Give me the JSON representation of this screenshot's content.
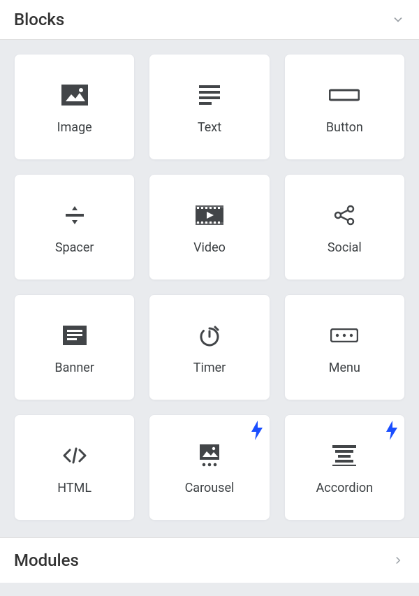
{
  "sections": {
    "blocks_title": "Blocks",
    "modules_title": "Modules"
  },
  "blocks": [
    {
      "label": "Image",
      "icon": "image-icon",
      "premium": false
    },
    {
      "label": "Text",
      "icon": "text-icon",
      "premium": false
    },
    {
      "label": "Button",
      "icon": "button-icon",
      "premium": false
    },
    {
      "label": "Spacer",
      "icon": "spacer-icon",
      "premium": false
    },
    {
      "label": "Video",
      "icon": "video-icon",
      "premium": false
    },
    {
      "label": "Social",
      "icon": "social-icon",
      "premium": false
    },
    {
      "label": "Banner",
      "icon": "banner-icon",
      "premium": false
    },
    {
      "label": "Timer",
      "icon": "timer-icon",
      "premium": false
    },
    {
      "label": "Menu",
      "icon": "menu-icon",
      "premium": false
    },
    {
      "label": "HTML",
      "icon": "html-icon",
      "premium": false
    },
    {
      "label": "Carousel",
      "icon": "carousel-icon",
      "premium": true
    },
    {
      "label": "Accordion",
      "icon": "accordion-icon",
      "premium": true
    }
  ]
}
